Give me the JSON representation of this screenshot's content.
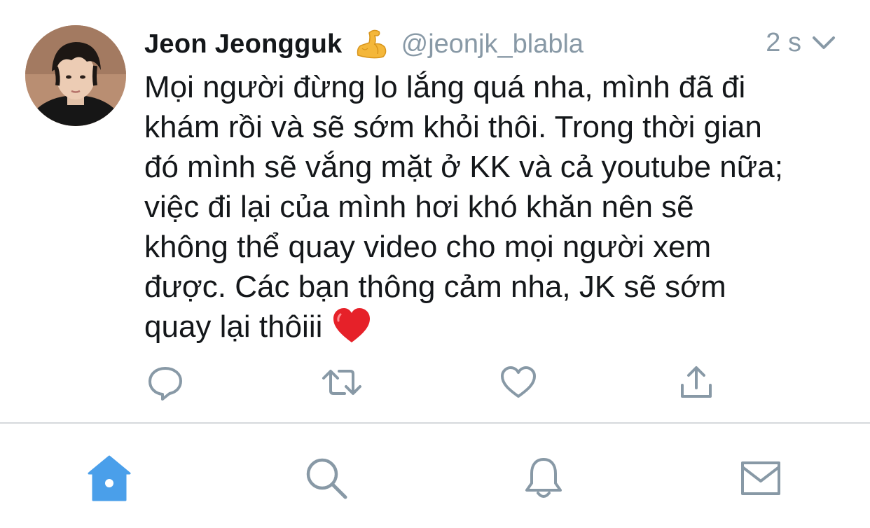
{
  "tweet": {
    "display_name": "Jeon Jeongguk",
    "handle": "@jeonjk_blabla",
    "time": "2 s",
    "name_emoji": "flexed-biceps-emoji",
    "text": "Mọi người đừng lo lắng quá nha, mình đã đi\nkhám rồi và sẽ sớm khỏi thôi. Trong thời gian\nđó mình sẽ vắng mặt ở KK và cả youtube nữa;\nviệc đi lại của mình hơi khó khăn nên sẽ\nkhông thể quay video cho mọi người xem\nđược. Các bạn thông cảm nha, JK sẽ sớm\nquay lại thôiii",
    "trailing_emoji": "red-heart-emoji"
  },
  "actions": [
    {
      "icon": "reply-icon"
    },
    {
      "icon": "retweet-icon"
    },
    {
      "icon": "like-icon"
    },
    {
      "icon": "share-icon"
    }
  ],
  "tabbar": [
    {
      "icon": "home-icon",
      "active": true
    },
    {
      "icon": "search-icon",
      "active": false
    },
    {
      "icon": "notifications-icon",
      "active": false
    },
    {
      "icon": "messages-icon",
      "active": false
    }
  ],
  "colors": {
    "accent": "#4a9fea",
    "icon_gray": "#8899a6",
    "text": "#14171a",
    "secondary_text": "#8899a6",
    "divider": "#d6d9dc"
  }
}
